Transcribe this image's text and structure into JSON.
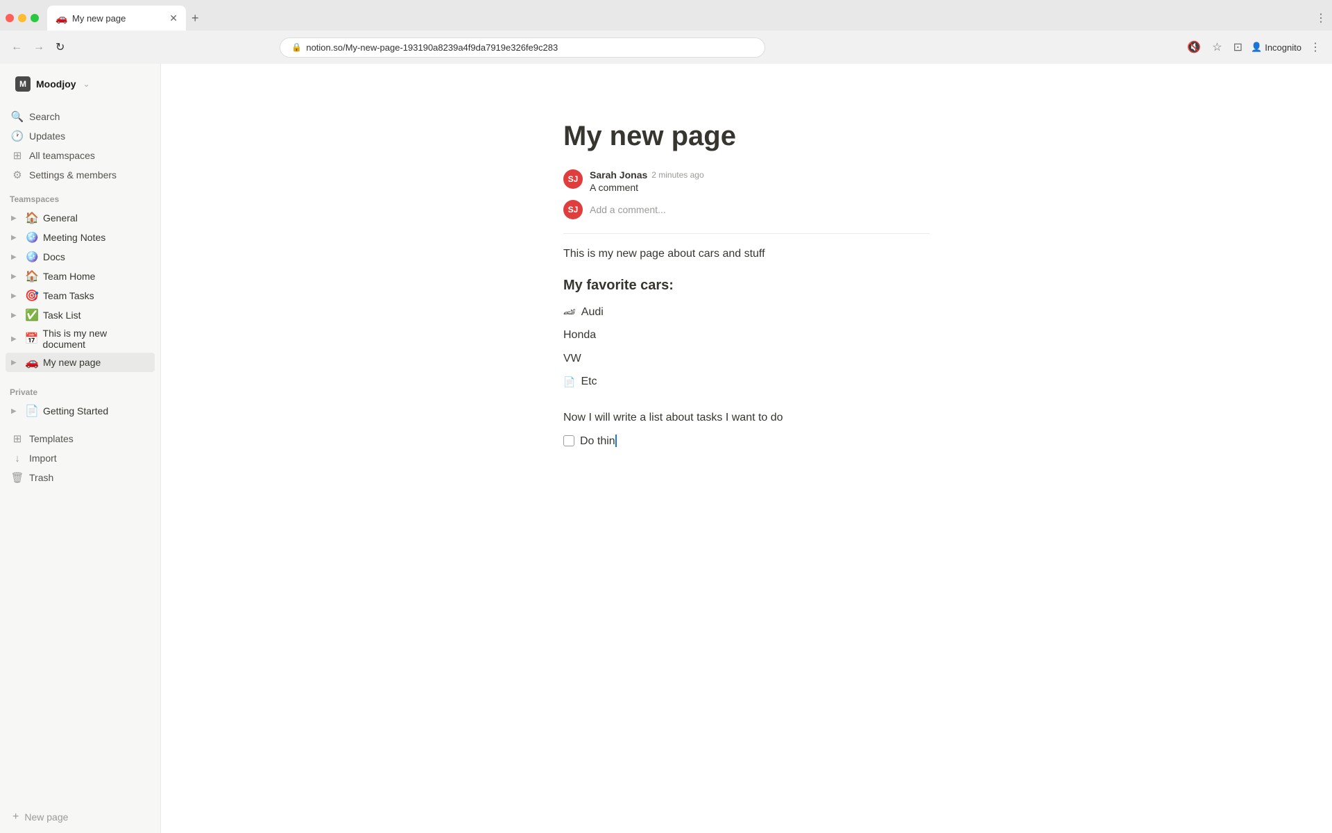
{
  "browser": {
    "tab_title": "My new page",
    "tab_favicon": "🚗",
    "new_tab_icon": "+",
    "url": "notion.so/My-new-page-193190a8239a4f9da7919e326fe9c283",
    "back_icon": "←",
    "forward_icon": "→",
    "refresh_icon": "↻",
    "lock_icon": "🔒",
    "bookmark_icon": "☆",
    "extension_icon": "⊡",
    "profile_icon": "👤",
    "incognito_label": "Incognito",
    "more_icon": "⋮",
    "mute_icon": "🔇"
  },
  "sidebar": {
    "workspace_initial": "M",
    "workspace_name": "Moodjoy",
    "workspace_chevron": "⌄",
    "search_label": "Search",
    "updates_label": "Updates",
    "all_teamspaces_label": "All teamspaces",
    "settings_label": "Settings & members",
    "teamspaces_section": "Teamspaces",
    "teamspaces": [
      {
        "icon": "🏠",
        "label": "General",
        "active": false
      },
      {
        "icon": "🪩",
        "label": "Meeting Notes",
        "active": false
      },
      {
        "icon": "🪩",
        "label": "Docs",
        "active": false
      },
      {
        "icon": "🏠",
        "label": "Team Home",
        "active": false
      },
      {
        "icon": "🎯",
        "label": "Team Tasks",
        "active": false
      },
      {
        "icon": "✅",
        "label": "Task List",
        "active": false
      },
      {
        "icon": "📅",
        "label": "This is my new document",
        "active": false
      },
      {
        "icon": "🚗",
        "label": "My new page",
        "active": true
      }
    ],
    "private_section": "Private",
    "private_items": [
      {
        "icon": "📄",
        "label": "Getting Started"
      }
    ],
    "templates_label": "Templates",
    "import_label": "Import",
    "trash_label": "Trash",
    "new_page_label": "New page"
  },
  "page": {
    "title": "My new page",
    "comment": {
      "author": "Sarah Jonas",
      "time": "2 minutes ago",
      "text": "A comment",
      "add_placeholder": "Add a comment..."
    },
    "intro": "This is my new page about cars and stuff",
    "section_title": "My favorite cars:",
    "cars": [
      {
        "icon": "🏎",
        "text": "Audi"
      },
      {
        "text": "Honda"
      },
      {
        "text": "VW"
      },
      {
        "icon": "📄",
        "text": "Etc",
        "is_link": true
      }
    ],
    "tasks_intro": "Now I will write a list about tasks I want to do",
    "tasks": [
      {
        "label": "Do thin",
        "checked": false,
        "cursor": true
      }
    ]
  }
}
